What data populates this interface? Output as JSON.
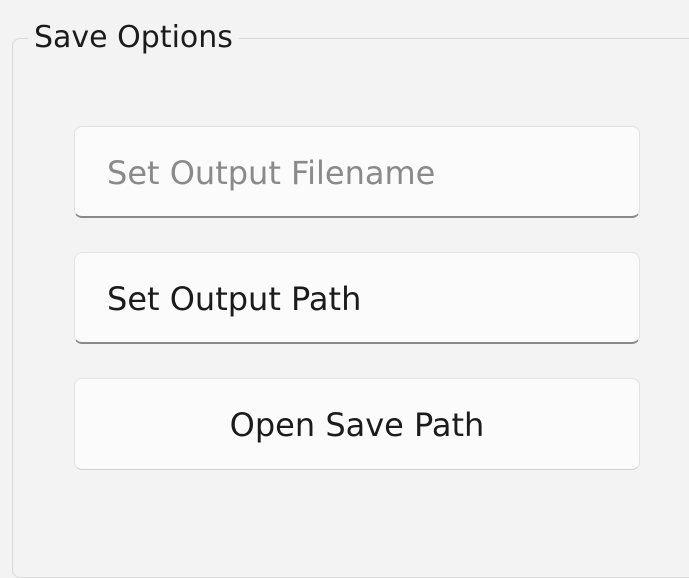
{
  "groupbox": {
    "title": "Save Options"
  },
  "output_filename": {
    "value": "",
    "placeholder": "Set Output Filename"
  },
  "output_path": {
    "value": "Set Output Path"
  },
  "open_save_path": {
    "label": "Open Save Path"
  },
  "colors": {
    "background": "#f3f3f3",
    "text": "#1b1b1b",
    "placeholder": "#8a8a8a",
    "border": "#e2e2e2"
  }
}
